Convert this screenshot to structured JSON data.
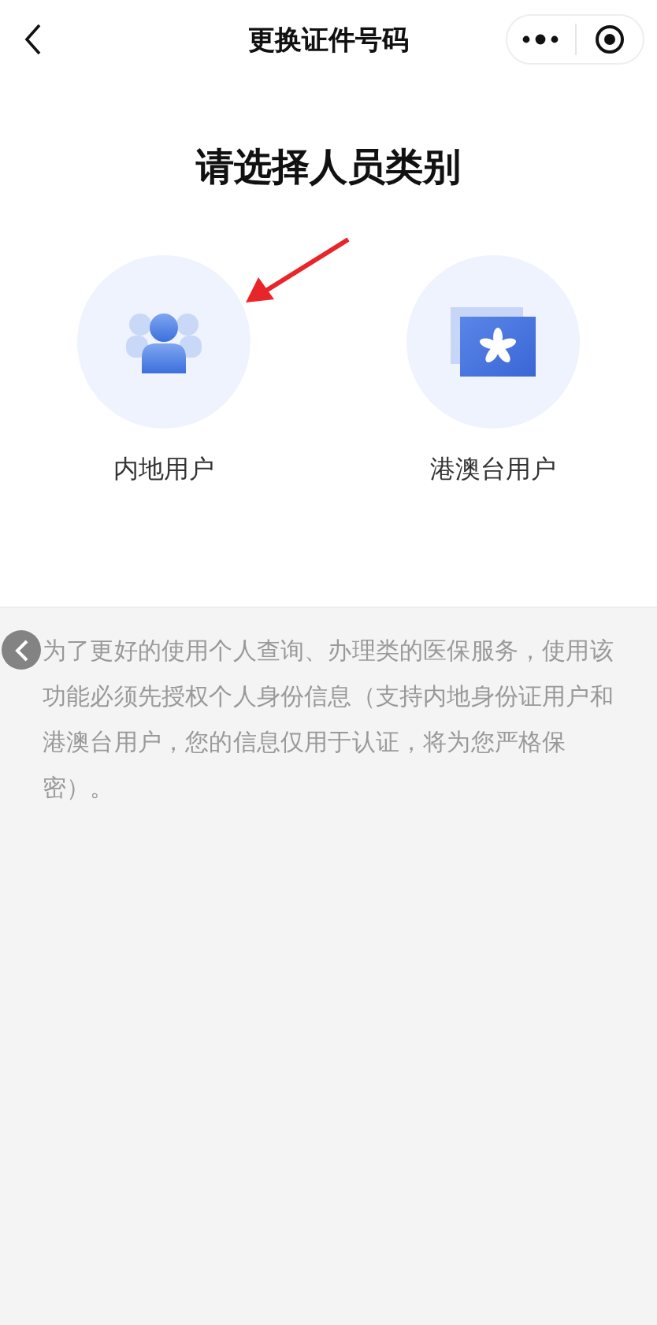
{
  "nav_bar": {
    "title": "更换证件号码"
  },
  "heading": "请选择人员类别",
  "options": [
    {
      "kind": "mainland",
      "label": "内地用户"
    },
    {
      "kind": "hkmotw",
      "label": "港澳台用户"
    }
  ],
  "notice": "为了更好的使用个人查询、办理类的医保服务，使用该功能必须先授权个人身份信息（支持内地身份证用户和港澳台用户，您的信息仅用于认证，将为您严格保密）。"
}
